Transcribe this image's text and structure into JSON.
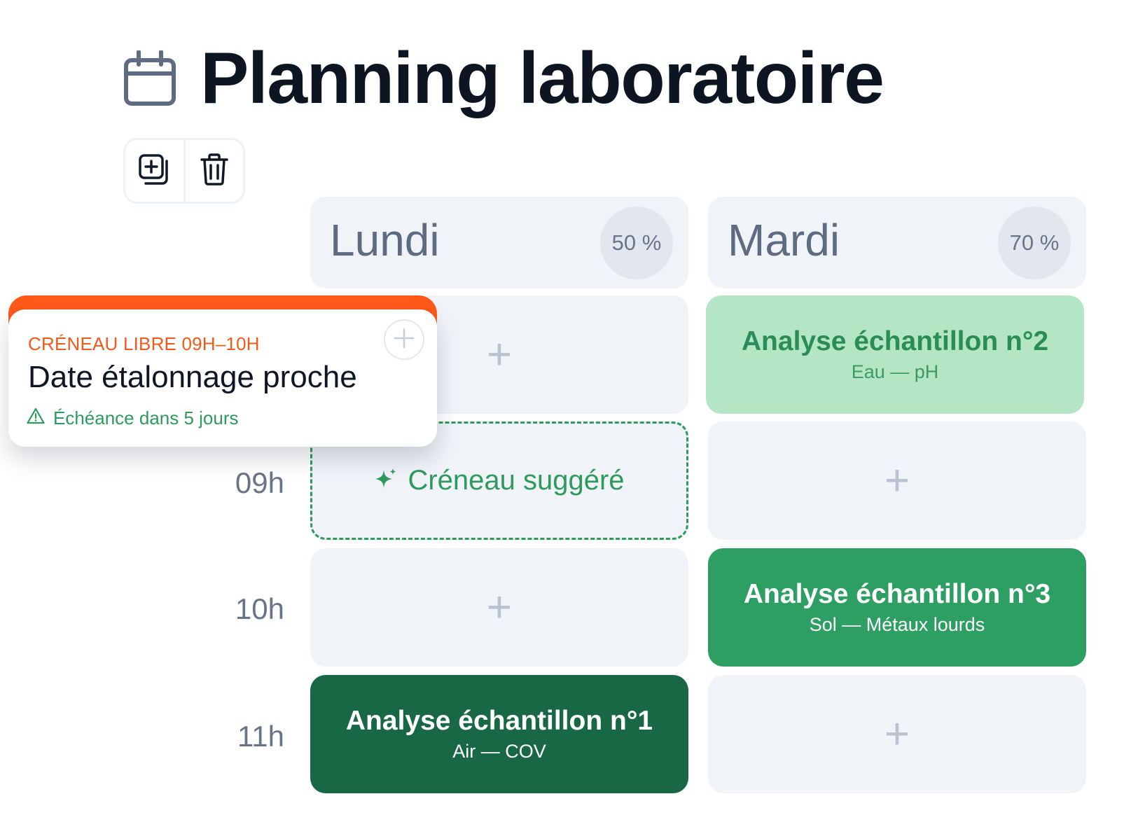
{
  "header": {
    "title": "Planning laboratoire",
    "icon": "calendar-icon"
  },
  "toolbar": {
    "buttons": [
      {
        "icon": "add-copy-icon"
      },
      {
        "icon": "trash-icon"
      }
    ]
  },
  "days": [
    {
      "name": "Lundi",
      "percent": "50 %"
    },
    {
      "name": "Mardi",
      "percent": "70 %"
    }
  ],
  "times": [
    "09h",
    "10h",
    "11h"
  ],
  "lundi": {
    "slot1": {
      "label": "+"
    },
    "slot2": {
      "label": "Créneau suggéré",
      "icon": "sparkle-icon"
    },
    "slot3": {
      "label": "+"
    },
    "slot4": {
      "title": "Analyse échantillon n°1",
      "subtitle": "Air — COV"
    }
  },
  "mardi": {
    "slot1": {
      "title": "Analyse échantillon n°2",
      "subtitle": "Eau — pH"
    },
    "slot2": {
      "label": "+"
    },
    "slot3": {
      "title": "Analyse échantillon n°3",
      "subtitle": "Sol — Métaux lourds"
    },
    "slot4": {
      "label": "+"
    }
  },
  "popup": {
    "kicker": "CRÉNEAU LIBRE 09H–10H",
    "title": "Date étalonnage proche",
    "warning": "Échéance dans 5 jours",
    "warning_icon": "warning-icon",
    "add_icon": "plus-icon"
  },
  "colors": {
    "accent_orange": "#ff5a1a",
    "green_light": "#b4e6c6",
    "green_mid": "#2e9f62",
    "green_dark": "#186845",
    "cell_bg": "#f0f3f8"
  }
}
